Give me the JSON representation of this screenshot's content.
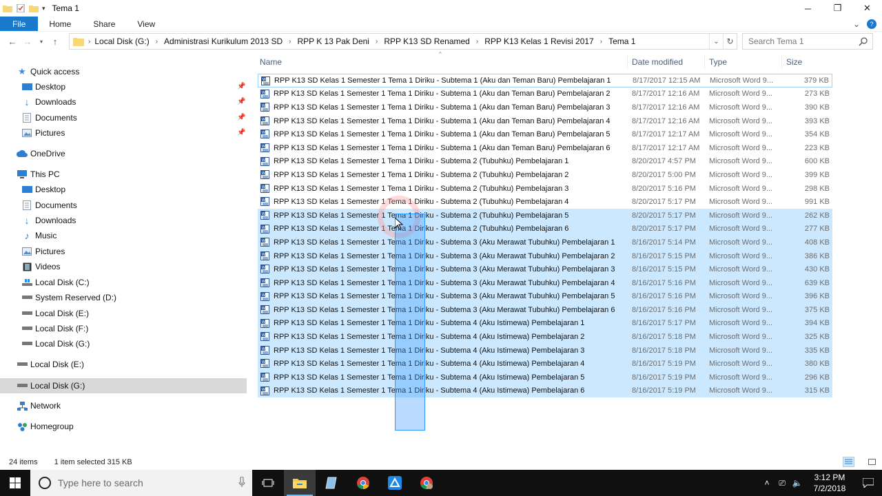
{
  "window": {
    "title": "Tema 1",
    "controls": {
      "minimize": "─",
      "restore": "❐",
      "close": "✕"
    }
  },
  "ribbon": {
    "tabs": [
      "File",
      "Home",
      "Share",
      "View"
    ],
    "collapse_glyph": "⌄",
    "help_glyph": "?"
  },
  "address": {
    "breadcrumbs": [
      "Local Disk (G:)",
      "Administrasi Kurikulum 2013 SD",
      "RPP K 13 Pak Deni",
      "RPP K13 SD Renamed",
      "RPP K13 Kelas 1 Revisi 2017",
      "Tema 1"
    ],
    "search_placeholder": "Search Tema 1"
  },
  "nav": {
    "quick_access": "Quick access",
    "quick_items": [
      "Desktop",
      "Downloads",
      "Documents",
      "Pictures"
    ],
    "onedrive": "OneDrive",
    "this_pc": "This PC",
    "pc_items": [
      "Desktop",
      "Documents",
      "Downloads",
      "Music",
      "Pictures",
      "Videos",
      "Local Disk (C:)",
      "System Reserved (D:)",
      "Local Disk (E:)",
      "Local Disk (F:)",
      "Local Disk (G:)"
    ],
    "drive_e": "Local Disk (E:)",
    "drive_g": "Local Disk (G:)",
    "network": "Network",
    "homegroup": "Homegroup"
  },
  "columns": {
    "name": "Name",
    "date": "Date modified",
    "type": "Type",
    "size": "Size"
  },
  "files": [
    {
      "name": "RPP K13 SD Kelas 1 Semester 1 Tema 1 Diriku - Subtema 1 (Aku dan Teman Baru) Pembelajaran 1",
      "date": "8/17/2017 12:15 AM",
      "type": "Microsoft Word 9...",
      "size": "379 KB",
      "selected": false
    },
    {
      "name": "RPP K13 SD Kelas 1 Semester 1 Tema 1 Diriku - Subtema 1 (Aku dan Teman Baru) Pembelajaran 2",
      "date": "8/17/2017 12:16 AM",
      "type": "Microsoft Word 9...",
      "size": "273 KB",
      "selected": false
    },
    {
      "name": "RPP K13 SD Kelas 1 Semester 1 Tema 1 Diriku - Subtema 1 (Aku dan Teman Baru) Pembelajaran 3",
      "date": "8/17/2017 12:16 AM",
      "type": "Microsoft Word 9...",
      "size": "390 KB",
      "selected": false
    },
    {
      "name": "RPP K13 SD Kelas 1 Semester 1 Tema 1 Diriku - Subtema 1 (Aku dan Teman Baru) Pembelajaran 4",
      "date": "8/17/2017 12:16 AM",
      "type": "Microsoft Word 9...",
      "size": "393 KB",
      "selected": false
    },
    {
      "name": "RPP K13 SD Kelas 1 Semester 1 Tema 1 Diriku - Subtema 1 (Aku dan Teman Baru) Pembelajaran 5",
      "date": "8/17/2017 12:17 AM",
      "type": "Microsoft Word 9...",
      "size": "354 KB",
      "selected": false
    },
    {
      "name": "RPP K13 SD Kelas 1 Semester 1 Tema 1 Diriku - Subtema 1 (Aku dan Teman Baru) Pembelajaran 6",
      "date": "8/17/2017 12:17 AM",
      "type": "Microsoft Word 9...",
      "size": "223 KB",
      "selected": false
    },
    {
      "name": "RPP K13 SD Kelas 1 Semester 1 Tema 1 Diriku - Subtema 2 (Tubuhku) Pembelajaran 1",
      "date": "8/20/2017 4:57 PM",
      "type": "Microsoft Word 9...",
      "size": "600 KB",
      "selected": false
    },
    {
      "name": "RPP K13 SD Kelas 1 Semester 1 Tema 1 Diriku - Subtema 2 (Tubuhku) Pembelajaran 2",
      "date": "8/20/2017 5:00 PM",
      "type": "Microsoft Word 9...",
      "size": "399 KB",
      "selected": false
    },
    {
      "name": "RPP K13 SD Kelas 1 Semester 1 Tema 1 Diriku - Subtema 2 (Tubuhku) Pembelajaran 3",
      "date": "8/20/2017 5:16 PM",
      "type": "Microsoft Word 9...",
      "size": "298 KB",
      "selected": false
    },
    {
      "name": "RPP K13 SD Kelas 1 Semester 1 Tema 1 Diriku - Subtema 2 (Tubuhku) Pembelajaran 4",
      "date": "8/20/2017 5:17 PM",
      "type": "Microsoft Word 9...",
      "size": "991 KB",
      "selected": false
    },
    {
      "name": "RPP K13 SD Kelas 1 Semester 1 Tema 1 Diriku - Subtema 2 (Tubuhku) Pembelajaran 5",
      "date": "8/20/2017 5:17 PM",
      "type": "Microsoft Word 9...",
      "size": "262 KB",
      "selected": true
    },
    {
      "name": "RPP K13 SD Kelas 1 Semester 1 Tema 1 Diriku - Subtema 2 (Tubuhku) Pembelajaran 6",
      "date": "8/20/2017 5:17 PM",
      "type": "Microsoft Word 9...",
      "size": "277 KB",
      "selected": true
    },
    {
      "name": "RPP K13 SD Kelas 1 Semester 1 Tema 1 Diriku - Subtema 3 (Aku Merawat Tubuhku) Pembelajaran 1",
      "date": "8/16/2017 5:14 PM",
      "type": "Microsoft Word 9...",
      "size": "408 KB",
      "selected": true
    },
    {
      "name": "RPP K13 SD Kelas 1 Semester 1 Tema 1 Diriku - Subtema 3 (Aku Merawat Tubuhku) Pembelajaran 2",
      "date": "8/16/2017 5:15 PM",
      "type": "Microsoft Word 9...",
      "size": "386 KB",
      "selected": true
    },
    {
      "name": "RPP K13 SD Kelas 1 Semester 1 Tema 1 Diriku - Subtema 3 (Aku Merawat Tubuhku) Pembelajaran 3",
      "date": "8/16/2017 5:15 PM",
      "type": "Microsoft Word 9...",
      "size": "430 KB",
      "selected": true
    },
    {
      "name": "RPP K13 SD Kelas 1 Semester 1 Tema 1 Diriku - Subtema 3 (Aku Merawat Tubuhku) Pembelajaran 4",
      "date": "8/16/2017 5:16 PM",
      "type": "Microsoft Word 9...",
      "size": "639 KB",
      "selected": true
    },
    {
      "name": "RPP K13 SD Kelas 1 Semester 1 Tema 1 Diriku - Subtema 3 (Aku Merawat Tubuhku) Pembelajaran 5",
      "date": "8/16/2017 5:16 PM",
      "type": "Microsoft Word 9...",
      "size": "396 KB",
      "selected": true
    },
    {
      "name": "RPP K13 SD Kelas 1 Semester 1 Tema 1 Diriku - Subtema 3 (Aku Merawat Tubuhku) Pembelajaran 6",
      "date": "8/16/2017 5:16 PM",
      "type": "Microsoft Word 9...",
      "size": "375 KB",
      "selected": true
    },
    {
      "name": "RPP K13 SD Kelas 1 Semester 1 Tema 1 Diriku - Subtema 4 (Aku Istimewa) Pembelajaran 1",
      "date": "8/16/2017 5:17 PM",
      "type": "Microsoft Word 9...",
      "size": "394 KB",
      "selected": true
    },
    {
      "name": "RPP K13 SD Kelas 1 Semester 1 Tema 1 Diriku - Subtema 4 (Aku Istimewa) Pembelajaran 2",
      "date": "8/16/2017 5:18 PM",
      "type": "Microsoft Word 9...",
      "size": "325 KB",
      "selected": true
    },
    {
      "name": "RPP K13 SD Kelas 1 Semester 1 Tema 1 Diriku - Subtema 4 (Aku Istimewa) Pembelajaran 3",
      "date": "8/16/2017 5:18 PM",
      "type": "Microsoft Word 9...",
      "size": "335 KB",
      "selected": true
    },
    {
      "name": "RPP K13 SD Kelas 1 Semester 1 Tema 1 Diriku - Subtema 4 (Aku Istimewa) Pembelajaran 4",
      "date": "8/16/2017 5:19 PM",
      "type": "Microsoft Word 9...",
      "size": "380 KB",
      "selected": true
    },
    {
      "name": "RPP K13 SD Kelas 1 Semester 1 Tema 1 Diriku - Subtema 4 (Aku Istimewa) Pembelajaran 5",
      "date": "8/16/2017 5:19 PM",
      "type": "Microsoft Word 9...",
      "size": "296 KB",
      "selected": true
    },
    {
      "name": "RPP K13 SD Kelas 1 Semester 1 Tema 1 Diriku - Subtema 4 (Aku Istimewa) Pembelajaran 6",
      "date": "8/16/2017 5:19 PM",
      "type": "Microsoft Word 9...",
      "size": "315 KB",
      "selected": true
    }
  ],
  "status": {
    "items": "24 items",
    "selected": "1 item selected  315 KB"
  },
  "taskbar": {
    "search_placeholder": "Type here to search",
    "time": "3:12 PM",
    "date": "7/2/2018"
  },
  "colors": {
    "accent": "#1979ca",
    "selection": "#cce8ff",
    "marquee": "#3399ff",
    "taskbar": "#101010"
  }
}
